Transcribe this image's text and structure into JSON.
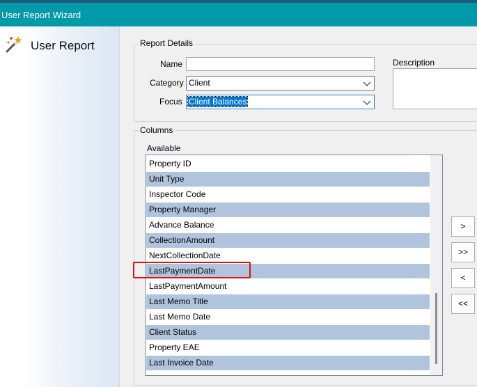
{
  "window": {
    "title": "User Report Wizard"
  },
  "left_pane": {
    "heading": "User Report",
    "icon": "magic-wand-icon"
  },
  "report_details": {
    "group_label": "Report Details",
    "name_label": "Name",
    "name_value": "",
    "category_label": "Category",
    "category_value": "Client",
    "focus_label": "Focus",
    "focus_value": "Client Balances",
    "description_label": "Description",
    "description_value": ""
  },
  "columns": {
    "group_label": "Columns",
    "available_label": "Available",
    "available_items": [
      "Property ID",
      "Unit Type",
      "Inspector Code",
      "Property Manager",
      "Advance Balance",
      "CollectionAmount",
      "NextCollectionDate",
      "LastPaymentDate",
      "LastPaymentAmount",
      "Last Memo Title",
      "Last Memo Date",
      "Client Status",
      "Property EAE",
      "Last Invoice Date"
    ],
    "highlighted_item": "LastPaymentDate"
  },
  "buttons": {
    "add": ">",
    "add_all": ">>",
    "remove": "<",
    "remove_all": "<<"
  },
  "colors": {
    "titlebar": "#009aa8",
    "alternate_row": "#b0c4de",
    "selection": "#0078d7",
    "annotation": "#e01010"
  }
}
